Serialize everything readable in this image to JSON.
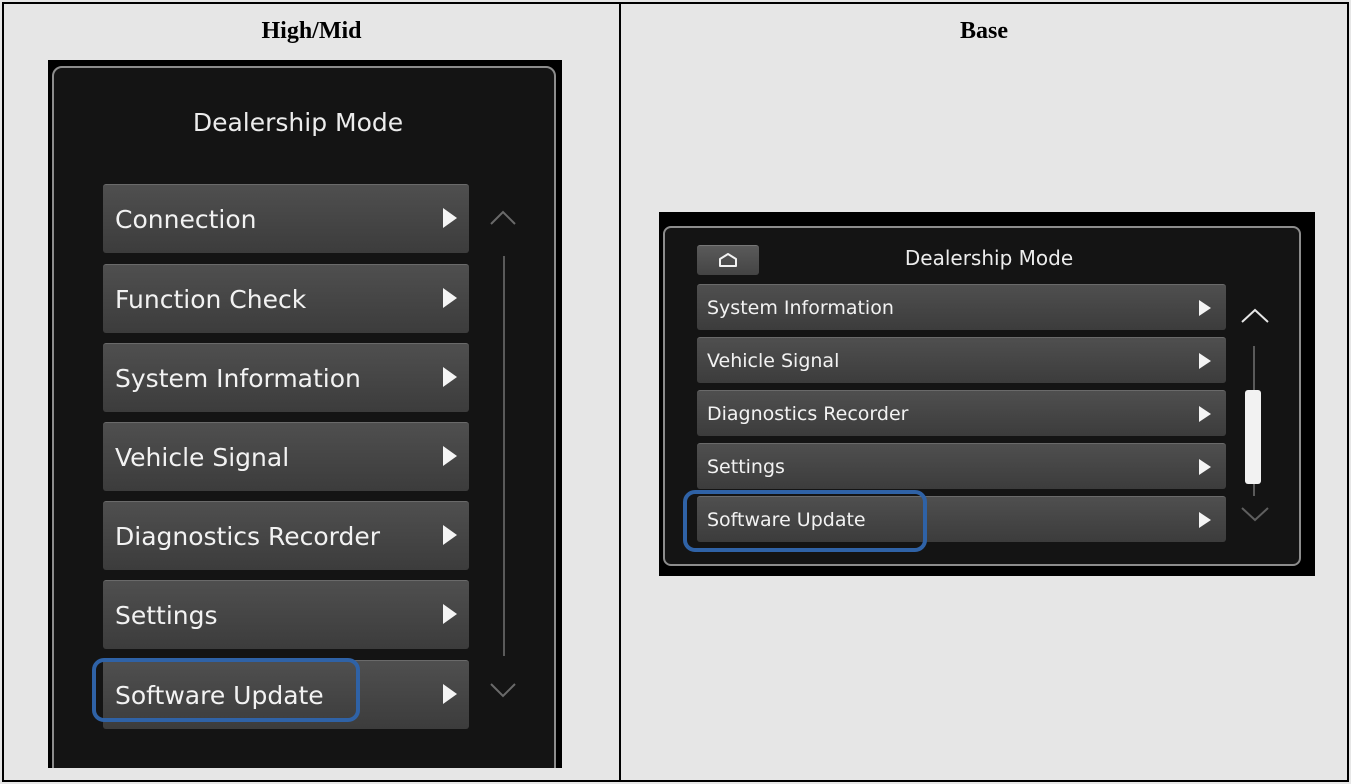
{
  "table": {
    "left_heading": "High/Mid",
    "right_heading": "Base"
  },
  "high_mid_screen": {
    "title": "Dealership Mode",
    "menu_items": [
      {
        "label": "Connection"
      },
      {
        "label": "Function Check"
      },
      {
        "label": "System Information"
      },
      {
        "label": "Vehicle Signal"
      },
      {
        "label": "Diagnostics Recorder"
      },
      {
        "label": "Settings"
      },
      {
        "label": "Software Update",
        "highlighted": true
      }
    ],
    "icons": {
      "scroll_up": "chevron-up-icon",
      "scroll_down": "chevron-down-icon",
      "item_arrow": "triangle-right-icon"
    }
  },
  "base_screen": {
    "title": "Dealership Mode",
    "home_icon": "home-icon",
    "menu_items": [
      {
        "label": "System Information"
      },
      {
        "label": "Vehicle Signal"
      },
      {
        "label": "Diagnostics Recorder"
      },
      {
        "label": "Settings"
      },
      {
        "label": "Software Update",
        "highlighted": true
      }
    ],
    "icons": {
      "scroll_up": "chevron-up-icon",
      "scroll_down": "chevron-down-icon",
      "item_arrow": "triangle-right-icon"
    }
  },
  "colors": {
    "highlight": "#2f62a6",
    "page_background": "#e6e6e6",
    "screen_background": "#141414"
  }
}
